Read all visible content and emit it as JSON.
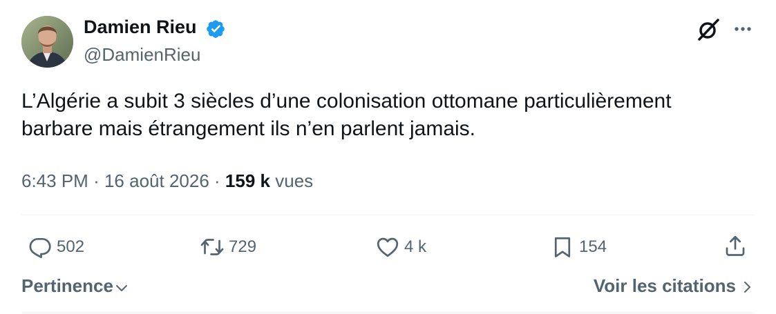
{
  "author": {
    "name": "Damien Rieu",
    "handle": "@DamienRieu",
    "verified_color": "#1d9bf0"
  },
  "icons": {
    "verified": "verified-badge-icon",
    "grok": "grok-icon",
    "more": "more-icon",
    "reply": "reply-icon",
    "repost": "repost-icon",
    "like": "heart-icon",
    "bookmark": "bookmark-icon",
    "share": "share-icon",
    "sort": "chevron-down-icon",
    "quotes": "chevron-right-icon"
  },
  "tweet": {
    "text": "L’Algérie a subit 3 siècles d’une colonisation ottomane particulièrement\nbarbare mais étrangement ils n’en parlent jamais.",
    "time": "6:43 PM",
    "date": "16 août 2026",
    "separator": "·",
    "views_count": "159 k",
    "views_label": "vues"
  },
  "actions": {
    "replies": "502",
    "reposts": "729",
    "likes": "4 k",
    "bookmarks": "154"
  },
  "footer": {
    "sort_label": "Pertinence",
    "quotes_label": "Voir les citations"
  },
  "colors": {
    "text": "#0f1419",
    "secondary": "#536471",
    "divider": "#eff3f4"
  }
}
